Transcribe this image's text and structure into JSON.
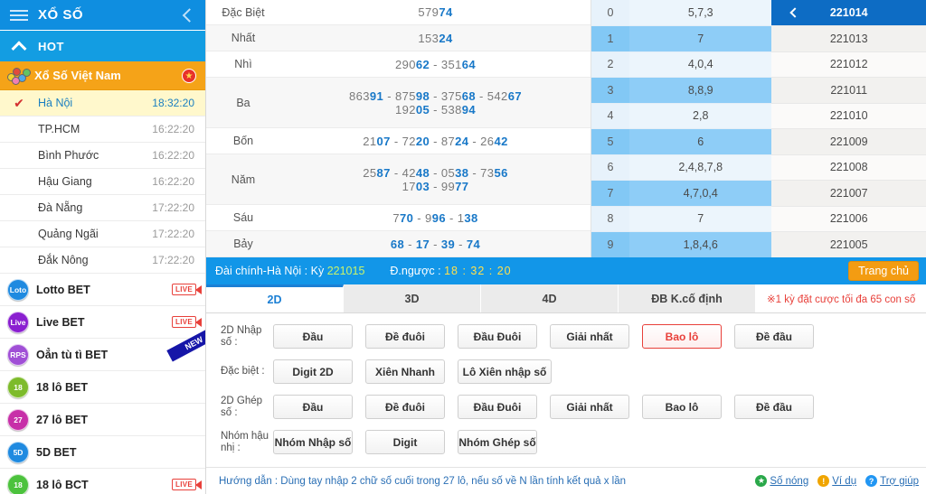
{
  "sidebar": {
    "title": "XỔ SỐ",
    "menu_icon": "hamburger-icon",
    "collapse_icon": "chevron-left-icon",
    "hot_label": "HOT",
    "vietnam_group": "Xổ Số Việt Nam",
    "regions": [
      {
        "name": "Hà Nội",
        "time": "18:32:20",
        "active": true
      },
      {
        "name": "TP.HCM",
        "time": "16:22:20",
        "active": false
      },
      {
        "name": "Bình Phước",
        "time": "16:22:20",
        "active": false
      },
      {
        "name": "Hậu Giang",
        "time": "16:22:20",
        "active": false
      },
      {
        "name": "Đà Nẵng",
        "time": "17:22:20",
        "active": false
      },
      {
        "name": "Quảng Ngãi",
        "time": "17:22:20",
        "active": false
      },
      {
        "name": "Đắk Nông",
        "time": "17:22:20",
        "active": false
      }
    ],
    "bet_games": [
      {
        "name": "Lotto BET",
        "icon": "Loto",
        "color": "#1f8ae0",
        "live": "LIVE",
        "new": false
      },
      {
        "name": "Live BET",
        "icon": "Live",
        "color": "#8a1fd0",
        "live": "LIVE",
        "new": false
      },
      {
        "name": "Oẳn tù tì BET",
        "icon": "RPS",
        "color": "#a04fd6",
        "live": "",
        "new": true
      },
      {
        "name": "18 lô BET",
        "icon": "18",
        "color": "#7dbb2b",
        "live": "",
        "new": false
      },
      {
        "name": "27 lô BET",
        "icon": "27",
        "color": "#c72fa8",
        "live": "",
        "new": false
      },
      {
        "name": "5D BET",
        "icon": "5D",
        "color": "#1f8ae0",
        "live": "",
        "new": false
      },
      {
        "name": "18 lô BCT",
        "icon": "18",
        "color": "#4cc23d",
        "live": "LIVE",
        "new": false
      }
    ]
  },
  "results": {
    "prizes": [
      {
        "label": "Đặc Biệt",
        "lines": [
          [
            {
              "p": "579",
              "b": "74"
            }
          ]
        ]
      },
      {
        "label": "Nhất",
        "lines": [
          [
            {
              "p": "153",
              "b": "24"
            }
          ]
        ]
      },
      {
        "label": "Nhì",
        "lines": [
          [
            {
              "p": "290",
              "b": "62"
            },
            {
              "p": "351",
              "b": "64"
            }
          ]
        ]
      },
      {
        "label": "Ba",
        "lines": [
          [
            {
              "p": "863",
              "b": "91"
            },
            {
              "p": "875",
              "b": "98"
            },
            {
              "p": "375",
              "b": "68"
            },
            {
              "p": "542",
              "b": "67"
            }
          ],
          [
            {
              "p": "192",
              "b": "05"
            },
            {
              "p": "538",
              "b": "94"
            }
          ]
        ]
      },
      {
        "label": "Bốn",
        "lines": [
          [
            {
              "p": "21",
              "b": "07"
            },
            {
              "p": "72",
              "b": "20"
            },
            {
              "p": "87",
              "b": "24"
            },
            {
              "p": "26",
              "b": "42"
            }
          ]
        ]
      },
      {
        "label": "Năm",
        "lines": [
          [
            {
              "p": "25",
              "b": "87"
            },
            {
              "p": "42",
              "b": "48"
            },
            {
              "p": "05",
              "b": "38"
            },
            {
              "p": "73",
              "b": "56"
            }
          ],
          [
            {
              "p": "17",
              "b": "03"
            },
            {
              "p": "99",
              "b": "77"
            }
          ]
        ]
      },
      {
        "label": "Sáu",
        "lines": [
          [
            {
              "p": "7",
              "b": "70"
            },
            {
              "p": "9",
              "b": "96"
            },
            {
              "p": "1",
              "b": "38"
            }
          ]
        ]
      },
      {
        "label": "Bảy",
        "lines": [
          [
            {
              "p": "",
              "b": "68"
            },
            {
              "p": "",
              "b": "17"
            },
            {
              "p": "",
              "b": "39"
            },
            {
              "p": "",
              "b": "74"
            }
          ]
        ]
      }
    ],
    "digit_rows": [
      {
        "key": "0",
        "values": "5,7,3"
      },
      {
        "key": "1",
        "values": "7"
      },
      {
        "key": "2",
        "values": "4,0,4"
      },
      {
        "key": "3",
        "values": "8,8,9"
      },
      {
        "key": "4",
        "values": "2,8"
      },
      {
        "key": "5",
        "values": "6"
      },
      {
        "key": "6",
        "values": "2,4,8,7,8"
      },
      {
        "key": "7",
        "values": "4,7,0,4"
      },
      {
        "key": "8",
        "values": "7"
      },
      {
        "key": "9",
        "values": "1,8,4,6"
      }
    ],
    "issues": [
      {
        "id": "221014",
        "selected": true
      },
      {
        "id": "221013",
        "selected": false
      },
      {
        "id": "221012",
        "selected": false
      },
      {
        "id": "221011",
        "selected": false
      },
      {
        "id": "221010",
        "selected": false
      },
      {
        "id": "221009",
        "selected": false
      },
      {
        "id": "221008",
        "selected": false
      },
      {
        "id": "221007",
        "selected": false
      },
      {
        "id": "221006",
        "selected": false
      },
      {
        "id": "221005",
        "selected": false
      }
    ]
  },
  "statusbar": {
    "station_label": "Đài chính-Hà Nội :",
    "issue_word": "Kỳ",
    "issue_number": "221015",
    "countdown_label": "Đ.ngược :",
    "countdown_value": "18 : 32 : 20",
    "home_button": "Trang chủ"
  },
  "tabs": {
    "items": [
      {
        "label": "2D",
        "active": true
      },
      {
        "label": "3D",
        "active": false
      },
      {
        "label": "4D",
        "active": false
      },
      {
        "label": "ĐB K.cố định",
        "active": false
      }
    ],
    "note": "※1 kỳ đặt cược tối đa 65 con số"
  },
  "bet_rows": [
    {
      "label": "2D Nhập số :",
      "buttons": [
        {
          "text": "Đầu",
          "selected": false,
          "wide": false
        },
        {
          "text": "Đề đuôi",
          "selected": false,
          "wide": false
        },
        {
          "text": "Đầu Đuôi",
          "selected": false,
          "wide": false
        },
        {
          "text": "Giải nhất",
          "selected": false,
          "wide": false
        },
        {
          "text": "Bao lô",
          "selected": true,
          "wide": false
        },
        {
          "text": "Đề đầu",
          "selected": false,
          "wide": false
        }
      ]
    },
    {
      "label": "Đặc biệt :",
      "buttons": [
        {
          "text": "Digit 2D",
          "selected": false,
          "wide": false
        },
        {
          "text": "Xiên Nhanh",
          "selected": false,
          "wide": false
        },
        {
          "text": "Lô Xiên nhập số",
          "selected": false,
          "wide": false
        }
      ]
    },
    {
      "label": "2D Ghép số :",
      "buttons": [
        {
          "text": "Đầu",
          "selected": false,
          "wide": false
        },
        {
          "text": "Đề đuôi",
          "selected": false,
          "wide": false
        },
        {
          "text": "Đầu Đuôi",
          "selected": false,
          "wide": false
        },
        {
          "text": "Giải nhất",
          "selected": false,
          "wide": false
        },
        {
          "text": "Bao lô",
          "selected": false,
          "wide": false
        },
        {
          "text": "Đề đầu",
          "selected": false,
          "wide": false
        }
      ]
    },
    {
      "label": "Nhóm hậu nhị :",
      "buttons": [
        {
          "text": "Nhóm Nhập số",
          "selected": false,
          "wide": false
        },
        {
          "text": "Digit",
          "selected": false,
          "wide": false
        },
        {
          "text": "Nhóm Ghép số",
          "selected": false,
          "wide": false
        }
      ]
    }
  ],
  "footer": {
    "guide": "Hướng dẫn : Dùng tay nhập 2 chữ số cuối trong 27 lô, nếu số về N lần tính kết quả x lần",
    "links": [
      {
        "text": "Số nóng",
        "icon": "star-icon",
        "color": "#2aa84a",
        "glyph": "★",
        "cls": "g"
      },
      {
        "text": "Ví dụ",
        "icon": "exclamation-icon",
        "color": "#f0a500",
        "glyph": "!",
        "cls": "y"
      },
      {
        "text": "Trợ giúp",
        "icon": "question-icon",
        "color": "#2196f3",
        "glyph": "?",
        "cls": "b"
      }
    ]
  }
}
